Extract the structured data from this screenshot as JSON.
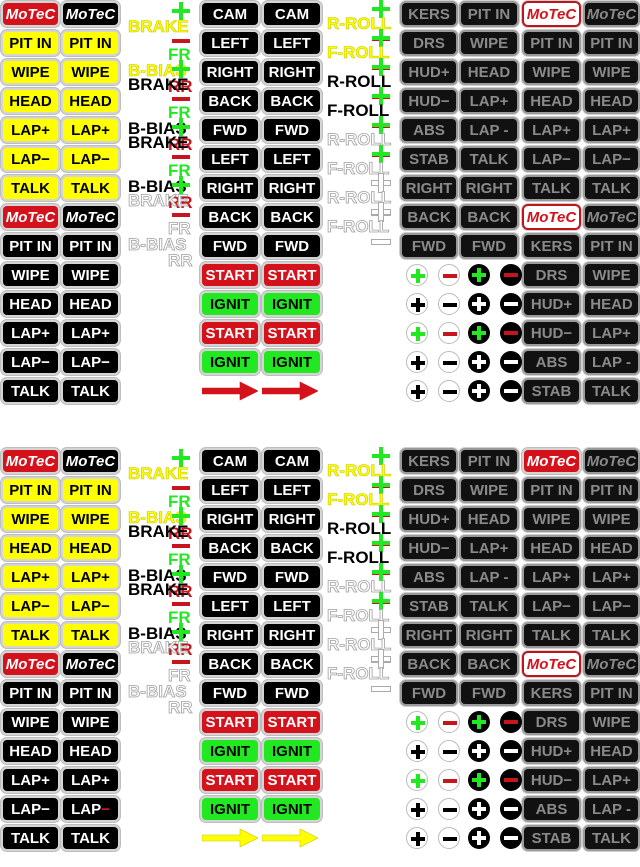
{
  "sheets": [
    {
      "name": "top",
      "colA": [
        {
          "label": "MoTeC",
          "style": "r",
          "italic": true
        },
        {
          "label": "PIT IN",
          "style": "y"
        },
        {
          "label": "WIPE",
          "style": "y"
        },
        {
          "label": "HEAD",
          "style": "y"
        },
        {
          "label": "LAP+",
          "style": "y"
        },
        {
          "label": "LAP−",
          "style": "y"
        },
        {
          "label": "TALK",
          "style": "y"
        },
        {
          "label": "MoTeC",
          "style": "r",
          "italic": true
        },
        {
          "label": "PIT IN",
          "style": "k"
        },
        {
          "label": "WIPE",
          "style": "k"
        },
        {
          "label": "HEAD",
          "style": "k"
        },
        {
          "label": "LAP+",
          "style": "k"
        },
        {
          "label": "LAP−",
          "style": "k"
        },
        {
          "label": "TALK",
          "style": "k"
        }
      ],
      "colB": [
        {
          "label": "MoTeC",
          "style": "k",
          "italic": true
        },
        {
          "label": "PIT IN",
          "style": "y"
        },
        {
          "label": "WIPE",
          "style": "y"
        },
        {
          "label": "HEAD",
          "style": "y"
        },
        {
          "label": "LAP+",
          "style": "y"
        },
        {
          "label": "LAP−",
          "style": "y"
        },
        {
          "label": "TALK",
          "style": "y"
        },
        {
          "label": "MoTeC",
          "style": "k",
          "italic": true
        },
        {
          "label": "PIT IN",
          "style": "k"
        },
        {
          "label": "WIPE",
          "style": "k"
        },
        {
          "label": "HEAD",
          "style": "k"
        },
        {
          "label": "LAP+",
          "style": "k"
        },
        {
          "label": "LAP−",
          "style": "k"
        },
        {
          "label": "TALK",
          "style": "k"
        }
      ],
      "colC": [
        {
          "label": "CAM",
          "style": "k"
        },
        {
          "label": "LEFT",
          "style": "k"
        },
        {
          "label": "RIGHT",
          "style": "k"
        },
        {
          "label": "BACK",
          "style": "k"
        },
        {
          "label": "FWD",
          "style": "k"
        },
        {
          "label": "LEFT",
          "style": "k"
        },
        {
          "label": "RIGHT",
          "style": "k"
        },
        {
          "label": "BACK",
          "style": "k"
        },
        {
          "label": "FWD",
          "style": "k"
        },
        {
          "label": "START",
          "style": "r"
        },
        {
          "label": "IGNIT",
          "style": "g"
        },
        {
          "label": "START",
          "style": "r"
        },
        {
          "label": "IGNIT",
          "style": "g"
        }
      ],
      "colD": [
        {
          "label": "CAM",
          "style": "k"
        },
        {
          "label": "LEFT",
          "style": "k"
        },
        {
          "label": "RIGHT",
          "style": "k"
        },
        {
          "label": "BACK",
          "style": "k"
        },
        {
          "label": "FWD",
          "style": "k"
        },
        {
          "label": "LEFT",
          "style": "k"
        },
        {
          "label": "RIGHT",
          "style": "k"
        },
        {
          "label": "BACK",
          "style": "k"
        },
        {
          "label": "FWD",
          "style": "k"
        },
        {
          "label": "START",
          "style": "r"
        },
        {
          "label": "IGNIT",
          "style": "g"
        },
        {
          "label": "START",
          "style": "r"
        },
        {
          "label": "IGNIT",
          "style": "g"
        }
      ],
      "arrow_color": "#d4121c",
      "colE": [
        "KERS",
        "DRS",
        "HUD+",
        "HUD−",
        "ABS",
        "STAB",
        "RIGHT",
        "BACK",
        "FWD"
      ],
      "colF": [
        "PIT IN",
        "WIPE",
        "HEAD",
        "LAP+",
        "LAP -",
        "TALK",
        "RIGHT",
        "BACK",
        "FWD"
      ],
      "colG": [
        {
          "label": "MoTeC",
          "style": "wr",
          "italic": true
        },
        {
          "label": "PIT IN",
          "style": "d"
        },
        {
          "label": "WIPE",
          "style": "d"
        },
        {
          "label": "HEAD",
          "style": "d"
        },
        {
          "label": "LAP+",
          "style": "d"
        },
        {
          "label": "LAP−",
          "style": "d"
        },
        {
          "label": "TALK",
          "style": "d"
        },
        {
          "label": "MoTeC",
          "style": "wr",
          "italic": true
        },
        {
          "label": "KERS",
          "style": "d"
        },
        {
          "label": "DRS",
          "style": "d"
        },
        {
          "label": "HUD+",
          "style": "d"
        },
        {
          "label": "HUD−",
          "style": "d"
        },
        {
          "label": "ABS",
          "style": "d"
        },
        {
          "label": "STAB",
          "style": "d"
        }
      ],
      "colH": [
        {
          "label": "MoTeC",
          "style": "d",
          "italic": true
        },
        {
          "label": "PIT IN",
          "style": "d"
        },
        {
          "label": "WIPE",
          "style": "d"
        },
        {
          "label": "HEAD",
          "style": "d"
        },
        {
          "label": "LAP+",
          "style": "d"
        },
        {
          "label": "LAP−",
          "style": "d"
        },
        {
          "label": "TALK",
          "style": "d"
        },
        {
          "label": "MoTeC",
          "style": "d",
          "italic": true
        },
        {
          "label": "PIT IN",
          "style": "d"
        },
        {
          "label": "WIPE",
          "style": "d"
        },
        {
          "label": "HEAD",
          "style": "d"
        },
        {
          "label": "LAP+",
          "style": "d"
        },
        {
          "label": "LAP -",
          "style": "d"
        },
        {
          "label": "TALK",
          "style": "d"
        }
      ],
      "brake_labels": [
        {
          "text": "BRAKE",
          "style": "ly",
          "plus": "#22e822",
          "minus": "#c8141c"
        },
        {
          "text": "BRAKE",
          "style": "lk",
          "plus": "#22e822",
          "minus": "#c8141c"
        },
        {
          "text": "BRAKE",
          "style": "lk",
          "plus": "#22e822",
          "minus": "#c8141c"
        },
        {
          "text": "BRAKE",
          "style": "lo",
          "plus": "#22e822",
          "minus": "#c8141c"
        }
      ],
      "bias_labels": [
        {
          "text": "B-BIAS",
          "style": "ly",
          "fr": "FR",
          "rr": "RR",
          "fr_style": "lg",
          "rr_style": "lr"
        },
        {
          "text": "B-BIAS",
          "style": "lk",
          "fr": "FR",
          "rr": "RR",
          "fr_style": "lg",
          "rr_style": "lr"
        },
        {
          "text": "B-BIAS",
          "style": "lk",
          "fr": "FR",
          "rr": "RR",
          "fr_style": "lg",
          "rr_style": "lr"
        },
        {
          "text": "B-BIAS",
          "style": "lo",
          "fr": "FR",
          "rr": "RR",
          "fr_style": "lo",
          "rr_style": "lo"
        }
      ],
      "roll_labels": [
        {
          "text": "R-ROLL",
          "style": "ly",
          "colored": true
        },
        {
          "text": "F-ROLL",
          "style": "ly",
          "colored": true
        },
        {
          "text": "R-ROLL",
          "style": "lk",
          "colored": true
        },
        {
          "text": "F-ROLL",
          "style": "lk",
          "colored": true
        },
        {
          "text": "R-ROLL",
          "style": "lo",
          "colored": true
        },
        {
          "text": "F-ROLL",
          "style": "lo",
          "colored": true
        },
        {
          "text": "R-ROLL",
          "style": "lo",
          "colored": false
        },
        {
          "text": "F-ROLL",
          "style": "lo",
          "colored": false
        }
      ],
      "circle_rows": [
        {
          "plus": "#22e822",
          "minus": "#c8141c"
        },
        {
          "plus": "#000000",
          "minus": "#000000"
        },
        {
          "plus": "#22e822",
          "minus": "#c8141c"
        },
        {
          "plus": "#000000",
          "minus": "#000000"
        },
        {
          "plus": "#000000",
          "minus": "#000000"
        }
      ]
    },
    {
      "name": "bottom",
      "colA": [
        {
          "label": "MoTeC",
          "style": "r",
          "italic": true
        },
        {
          "label": "PIT IN",
          "style": "y"
        },
        {
          "label": "WIPE",
          "style": "y"
        },
        {
          "label": "HEAD",
          "style": "y"
        },
        {
          "label": "LAP+",
          "style": "y"
        },
        {
          "label": "LAP−",
          "style": "y"
        },
        {
          "label": "TALK",
          "style": "y"
        },
        {
          "label": "MoTeC",
          "style": "r",
          "italic": true
        },
        {
          "label": "PIT IN",
          "style": "k"
        },
        {
          "label": "WIPE",
          "style": "k"
        },
        {
          "label": "HEAD",
          "style": "k"
        },
        {
          "label": "LAP+",
          "style": "k"
        },
        {
          "label": "LAP−",
          "style": "k"
        },
        {
          "label": "TALK",
          "style": "k"
        }
      ],
      "colB": [
        {
          "label": "MoTeC",
          "style": "k",
          "italic": true
        },
        {
          "label": "PIT IN",
          "style": "y"
        },
        {
          "label": "WIPE",
          "style": "y"
        },
        {
          "label": "HEAD",
          "style": "y"
        },
        {
          "label": "LAP+",
          "style": "y"
        },
        {
          "label": "LAP−",
          "style": "y"
        },
        {
          "label": "TALK",
          "style": "y"
        },
        {
          "label": "MoTeC",
          "style": "k",
          "italic": true
        },
        {
          "label": "PIT IN",
          "style": "k"
        },
        {
          "label": "WIPE",
          "style": "k"
        },
        {
          "label": "HEAD",
          "style": "k"
        },
        {
          "label": "LAP+",
          "style": "k"
        },
        {
          "label": "LAP−",
          "style": "k",
          "red_dash": true
        },
        {
          "label": "TALK",
          "style": "k"
        }
      ],
      "colC": [
        {
          "label": "CAM",
          "style": "k"
        },
        {
          "label": "LEFT",
          "style": "k"
        },
        {
          "label": "RIGHT",
          "style": "k"
        },
        {
          "label": "BACK",
          "style": "k"
        },
        {
          "label": "FWD",
          "style": "k"
        },
        {
          "label": "LEFT",
          "style": "k"
        },
        {
          "label": "RIGHT",
          "style": "k"
        },
        {
          "label": "BACK",
          "style": "k"
        },
        {
          "label": "FWD",
          "style": "k"
        },
        {
          "label": "START",
          "style": "r"
        },
        {
          "label": "IGNIT",
          "style": "g"
        },
        {
          "label": "START",
          "style": "r"
        },
        {
          "label": "IGNIT",
          "style": "g"
        }
      ],
      "colD": [
        {
          "label": "CAM",
          "style": "k"
        },
        {
          "label": "LEFT",
          "style": "k"
        },
        {
          "label": "RIGHT",
          "style": "k"
        },
        {
          "label": "BACK",
          "style": "k"
        },
        {
          "label": "FWD",
          "style": "k"
        },
        {
          "label": "LEFT",
          "style": "k"
        },
        {
          "label": "RIGHT",
          "style": "k"
        },
        {
          "label": "BACK",
          "style": "k"
        },
        {
          "label": "FWD",
          "style": "k"
        },
        {
          "label": "START",
          "style": "r"
        },
        {
          "label": "IGNIT",
          "style": "g"
        },
        {
          "label": "START",
          "style": "r"
        },
        {
          "label": "IGNIT",
          "style": "g"
        }
      ],
      "arrow_color": "#ffff00",
      "colE": [
        "KERS",
        "DRS",
        "HUD+",
        "HUD−",
        "ABS",
        "STAB",
        "RIGHT",
        "BACK",
        "FWD"
      ],
      "colF": [
        "PIT IN",
        "WIPE",
        "HEAD",
        "LAP+",
        "LAP -",
        "TALK",
        "RIGHT",
        "BACK",
        "FWD"
      ],
      "colG": [
        {
          "label": "MoTeC",
          "style": "r",
          "italic": true
        },
        {
          "label": "PIT IN",
          "style": "d"
        },
        {
          "label": "WIPE",
          "style": "d"
        },
        {
          "label": "HEAD",
          "style": "d"
        },
        {
          "label": "LAP+",
          "style": "d"
        },
        {
          "label": "LAP−",
          "style": "d"
        },
        {
          "label": "TALK",
          "style": "d"
        },
        {
          "label": "MoTeC",
          "style": "wr",
          "italic": true
        },
        {
          "label": "KERS",
          "style": "d"
        },
        {
          "label": "DRS",
          "style": "d"
        },
        {
          "label": "HUD+",
          "style": "d"
        },
        {
          "label": "HUD−",
          "style": "d"
        },
        {
          "label": "ABS",
          "style": "d"
        },
        {
          "label": "STAB",
          "style": "d"
        }
      ],
      "colH": [
        {
          "label": "MoTeC",
          "style": "d",
          "italic": true
        },
        {
          "label": "PIT IN",
          "style": "d"
        },
        {
          "label": "WIPE",
          "style": "d"
        },
        {
          "label": "HEAD",
          "style": "d"
        },
        {
          "label": "LAP+",
          "style": "d"
        },
        {
          "label": "LAP−",
          "style": "d"
        },
        {
          "label": "TALK",
          "style": "d"
        },
        {
          "label": "MoTeC",
          "style": "d",
          "italic": true
        },
        {
          "label": "PIT IN",
          "style": "d"
        },
        {
          "label": "WIPE",
          "style": "d"
        },
        {
          "label": "HEAD",
          "style": "d"
        },
        {
          "label": "LAP+",
          "style": "d"
        },
        {
          "label": "LAP -",
          "style": "d"
        },
        {
          "label": "TALK",
          "style": "d"
        }
      ],
      "brake_labels": [
        {
          "text": "BRAKE",
          "style": "ly",
          "plus": "#22e822",
          "minus": "#c8141c"
        },
        {
          "text": "BRAKE",
          "style": "lk",
          "plus": "#22e822",
          "minus": "#c8141c"
        },
        {
          "text": "BRAKE",
          "style": "lk",
          "plus": "#22e822",
          "minus": "#c8141c"
        },
        {
          "text": "BRAKE",
          "style": "lo",
          "plus": "#22e822",
          "minus": "#c8141c"
        }
      ],
      "bias_labels": [
        {
          "text": "B-BIAS",
          "style": "ly",
          "fr": "FR",
          "rr": "RR",
          "fr_style": "lg",
          "rr_style": "lr"
        },
        {
          "text": "B-BIAS",
          "style": "lk",
          "fr": "FR",
          "rr": "RR",
          "fr_style": "lg",
          "rr_style": "lr"
        },
        {
          "text": "B-BIAS",
          "style": "lk",
          "fr": "FR",
          "rr": "RR",
          "fr_style": "lg",
          "rr_style": "lr"
        },
        {
          "text": "B-BIAS",
          "style": "lo",
          "fr": "FR",
          "rr": "RR",
          "fr_style": "lo",
          "rr_style": "lo"
        }
      ],
      "roll_labels": [
        {
          "text": "R-ROLL",
          "style": "ly",
          "colored": true
        },
        {
          "text": "F-ROLL",
          "style": "ly",
          "colored": true
        },
        {
          "text": "R-ROLL",
          "style": "lk",
          "colored": true
        },
        {
          "text": "F-ROLL",
          "style": "lk",
          "colored": true
        },
        {
          "text": "R-ROLL",
          "style": "lo",
          "colored": true
        },
        {
          "text": "F-ROLL",
          "style": "lo",
          "colored": true
        },
        {
          "text": "R-ROLL",
          "style": "lo",
          "colored": false
        },
        {
          "text": "F-ROLL",
          "style": "lo",
          "colored": false
        }
      ],
      "circle_rows": [
        {
          "plus": "#22e822",
          "minus": "#c8141c"
        },
        {
          "plus": "#000000",
          "minus": "#000000"
        },
        {
          "plus": "#22e822",
          "minus": "#c8141c"
        },
        {
          "plus": "#000000",
          "minus": "#000000"
        },
        {
          "plus": "#000000",
          "minus": "#000000"
        }
      ]
    }
  ]
}
